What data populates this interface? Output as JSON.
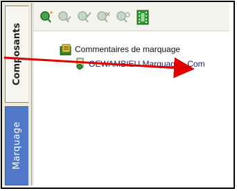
{
  "sidebar": {
    "tabs": [
      {
        "label": "Composants",
        "active": true
      },
      {
        "label": "Marquage",
        "active": false
      }
    ]
  },
  "toolbar": {
    "icons": [
      "add-markup-icon",
      "edit-markup-icon",
      "accept-markup-icon",
      "reject-markup-icon",
      "settings-markup-icon",
      "film-icon"
    ]
  },
  "tree": {
    "root_label": "Commentaires de marquage",
    "child_label": "OEWAMBIEU Marquage - Com"
  },
  "colors": {
    "active_tab": "#4f78c8",
    "arrow": "#e00000",
    "folder": "#2a8a2a"
  }
}
